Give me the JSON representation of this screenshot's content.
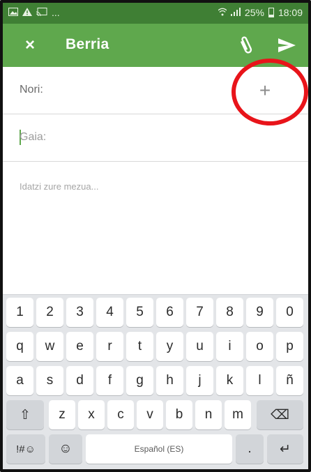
{
  "status_bar": {
    "left_icons": [
      "image-icon",
      "alert-icon",
      "cast-icon"
    ],
    "ellipsis": "...",
    "battery": "25%",
    "time": "18:09",
    "battery_level": 0.25
  },
  "app_bar": {
    "title": "Berria",
    "close_icon": "×",
    "attach_icon": "paperclip-icon",
    "send_icon": "send-icon",
    "background": "#5fa84d"
  },
  "form": {
    "to_label": "Nori:",
    "add_recipient_symbol": "+",
    "subject_placeholder": "Gaia:",
    "message_placeholder": "Idatzi zure mezua..."
  },
  "keyboard": {
    "row_numbers": [
      "1",
      "2",
      "3",
      "4",
      "5",
      "6",
      "7",
      "8",
      "9",
      "0"
    ],
    "row_1": [
      "q",
      "w",
      "e",
      "r",
      "t",
      "y",
      "u",
      "i",
      "o",
      "p"
    ],
    "row_2": [
      "a",
      "s",
      "d",
      "f",
      "g",
      "h",
      "j",
      "k",
      "l",
      "ñ"
    ],
    "row_3": [
      "z",
      "x",
      "c",
      "v",
      "b",
      "n",
      "m"
    ],
    "shift_symbol": "⇧",
    "backspace_symbol": "⌫",
    "symbols_label": "!#☺",
    "emoji_symbol": "☺",
    "space_label": "Español (ES)",
    "period": ".",
    "enter_symbol": "↵"
  },
  "annotation": {
    "circle_color": "#e8141a"
  }
}
